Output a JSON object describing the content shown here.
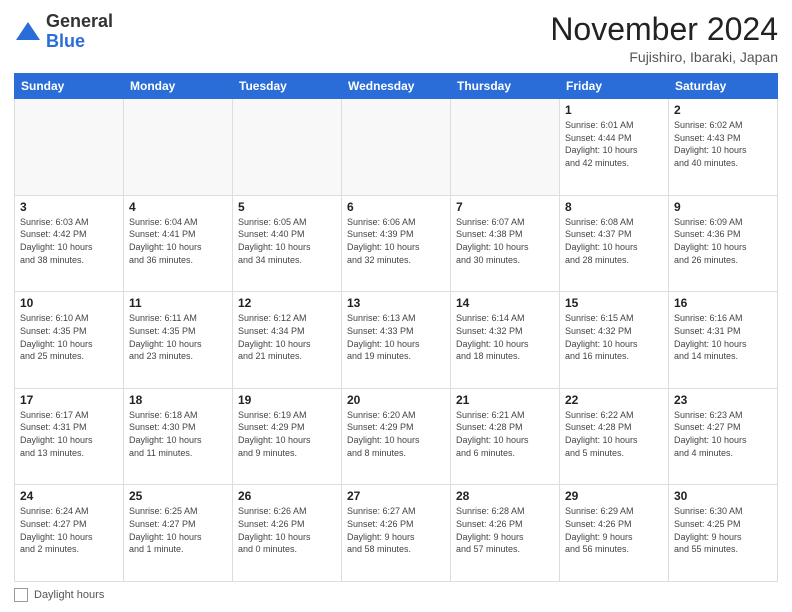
{
  "logo": {
    "general": "General",
    "blue": "Blue"
  },
  "header": {
    "title": "November 2024",
    "subtitle": "Fujishiro, Ibaraki, Japan"
  },
  "weekdays": [
    "Sunday",
    "Monday",
    "Tuesday",
    "Wednesday",
    "Thursday",
    "Friday",
    "Saturday"
  ],
  "weeks": [
    [
      {
        "day": "",
        "info": ""
      },
      {
        "day": "",
        "info": ""
      },
      {
        "day": "",
        "info": ""
      },
      {
        "day": "",
        "info": ""
      },
      {
        "day": "",
        "info": ""
      },
      {
        "day": "1",
        "info": "Sunrise: 6:01 AM\nSunset: 4:44 PM\nDaylight: 10 hours\nand 42 minutes."
      },
      {
        "day": "2",
        "info": "Sunrise: 6:02 AM\nSunset: 4:43 PM\nDaylight: 10 hours\nand 40 minutes."
      }
    ],
    [
      {
        "day": "3",
        "info": "Sunrise: 6:03 AM\nSunset: 4:42 PM\nDaylight: 10 hours\nand 38 minutes."
      },
      {
        "day": "4",
        "info": "Sunrise: 6:04 AM\nSunset: 4:41 PM\nDaylight: 10 hours\nand 36 minutes."
      },
      {
        "day": "5",
        "info": "Sunrise: 6:05 AM\nSunset: 4:40 PM\nDaylight: 10 hours\nand 34 minutes."
      },
      {
        "day": "6",
        "info": "Sunrise: 6:06 AM\nSunset: 4:39 PM\nDaylight: 10 hours\nand 32 minutes."
      },
      {
        "day": "7",
        "info": "Sunrise: 6:07 AM\nSunset: 4:38 PM\nDaylight: 10 hours\nand 30 minutes."
      },
      {
        "day": "8",
        "info": "Sunrise: 6:08 AM\nSunset: 4:37 PM\nDaylight: 10 hours\nand 28 minutes."
      },
      {
        "day": "9",
        "info": "Sunrise: 6:09 AM\nSunset: 4:36 PM\nDaylight: 10 hours\nand 26 minutes."
      }
    ],
    [
      {
        "day": "10",
        "info": "Sunrise: 6:10 AM\nSunset: 4:35 PM\nDaylight: 10 hours\nand 25 minutes."
      },
      {
        "day": "11",
        "info": "Sunrise: 6:11 AM\nSunset: 4:35 PM\nDaylight: 10 hours\nand 23 minutes."
      },
      {
        "day": "12",
        "info": "Sunrise: 6:12 AM\nSunset: 4:34 PM\nDaylight: 10 hours\nand 21 minutes."
      },
      {
        "day": "13",
        "info": "Sunrise: 6:13 AM\nSunset: 4:33 PM\nDaylight: 10 hours\nand 19 minutes."
      },
      {
        "day": "14",
        "info": "Sunrise: 6:14 AM\nSunset: 4:32 PM\nDaylight: 10 hours\nand 18 minutes."
      },
      {
        "day": "15",
        "info": "Sunrise: 6:15 AM\nSunset: 4:32 PM\nDaylight: 10 hours\nand 16 minutes."
      },
      {
        "day": "16",
        "info": "Sunrise: 6:16 AM\nSunset: 4:31 PM\nDaylight: 10 hours\nand 14 minutes."
      }
    ],
    [
      {
        "day": "17",
        "info": "Sunrise: 6:17 AM\nSunset: 4:31 PM\nDaylight: 10 hours\nand 13 minutes."
      },
      {
        "day": "18",
        "info": "Sunrise: 6:18 AM\nSunset: 4:30 PM\nDaylight: 10 hours\nand 11 minutes."
      },
      {
        "day": "19",
        "info": "Sunrise: 6:19 AM\nSunset: 4:29 PM\nDaylight: 10 hours\nand 9 minutes."
      },
      {
        "day": "20",
        "info": "Sunrise: 6:20 AM\nSunset: 4:29 PM\nDaylight: 10 hours\nand 8 minutes."
      },
      {
        "day": "21",
        "info": "Sunrise: 6:21 AM\nSunset: 4:28 PM\nDaylight: 10 hours\nand 6 minutes."
      },
      {
        "day": "22",
        "info": "Sunrise: 6:22 AM\nSunset: 4:28 PM\nDaylight: 10 hours\nand 5 minutes."
      },
      {
        "day": "23",
        "info": "Sunrise: 6:23 AM\nSunset: 4:27 PM\nDaylight: 10 hours\nand 4 minutes."
      }
    ],
    [
      {
        "day": "24",
        "info": "Sunrise: 6:24 AM\nSunset: 4:27 PM\nDaylight: 10 hours\nand 2 minutes."
      },
      {
        "day": "25",
        "info": "Sunrise: 6:25 AM\nSunset: 4:27 PM\nDaylight: 10 hours\nand 1 minute."
      },
      {
        "day": "26",
        "info": "Sunrise: 6:26 AM\nSunset: 4:26 PM\nDaylight: 10 hours\nand 0 minutes."
      },
      {
        "day": "27",
        "info": "Sunrise: 6:27 AM\nSunset: 4:26 PM\nDaylight: 9 hours\nand 58 minutes."
      },
      {
        "day": "28",
        "info": "Sunrise: 6:28 AM\nSunset: 4:26 PM\nDaylight: 9 hours\nand 57 minutes."
      },
      {
        "day": "29",
        "info": "Sunrise: 6:29 AM\nSunset: 4:26 PM\nDaylight: 9 hours\nand 56 minutes."
      },
      {
        "day": "30",
        "info": "Sunrise: 6:30 AM\nSunset: 4:25 PM\nDaylight: 9 hours\nand 55 minutes."
      }
    ]
  ],
  "footer": {
    "label": "Daylight hours"
  }
}
